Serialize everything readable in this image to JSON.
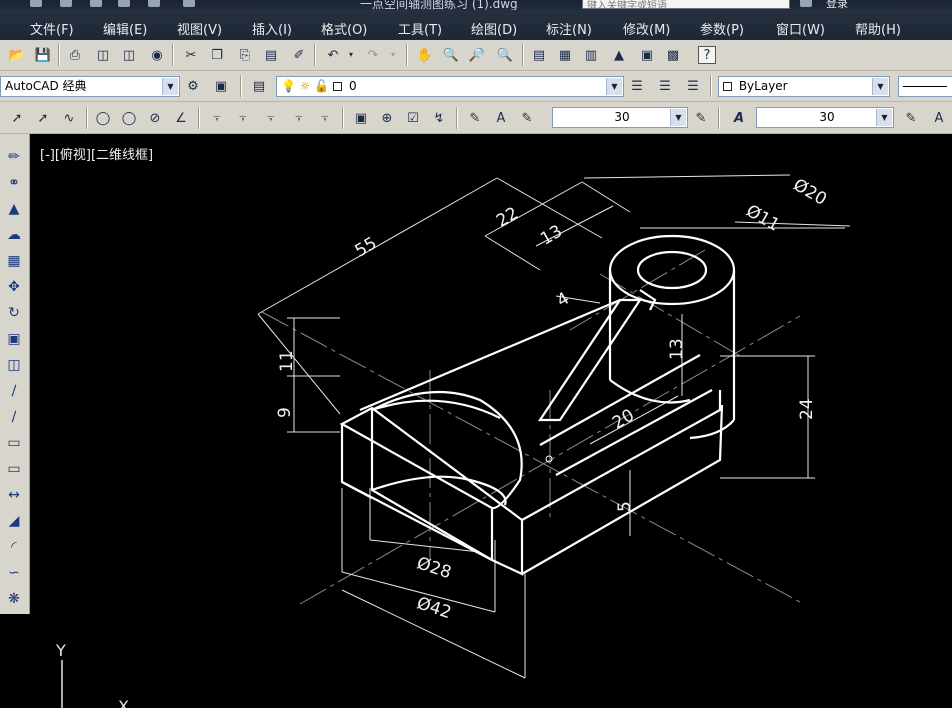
{
  "title": {
    "filename": "一点空间轴测图练习 (1).dwg",
    "search_placeholder": "键入关键字或短语",
    "login_label": "登录"
  },
  "menu": [
    "文件(F)",
    "编辑(E)",
    "视图(V)",
    "插入(I)",
    "格式(O)",
    "工具(T)",
    "绘图(D)",
    "标注(N)",
    "修改(M)",
    "参数(P)",
    "窗口(W)",
    "帮助(H)"
  ],
  "toolbar2": {
    "workspace_value": "AutoCAD 经典",
    "layer_value": "0",
    "color_value": "ByLayer"
  },
  "toolbar3": {
    "dimscale_value": "30",
    "textheight_value": "30"
  },
  "canvas": {
    "view_label": "[-][俯视][二维线框]",
    "ucs_y_label": "Y",
    "ucs_x_label": "X",
    "dimensions": [
      "55",
      "22",
      "13",
      "Ø20",
      "Ø11",
      "4",
      "11",
      "9",
      "13",
      "24",
      "20",
      "5",
      "Ø28",
      "Ø42"
    ]
  },
  "colors": {
    "canvas_bg": "#000000",
    "lines": "#ffffff",
    "toolbar_bg": "#d8d5cc",
    "menubar_bg": "#222b39"
  }
}
